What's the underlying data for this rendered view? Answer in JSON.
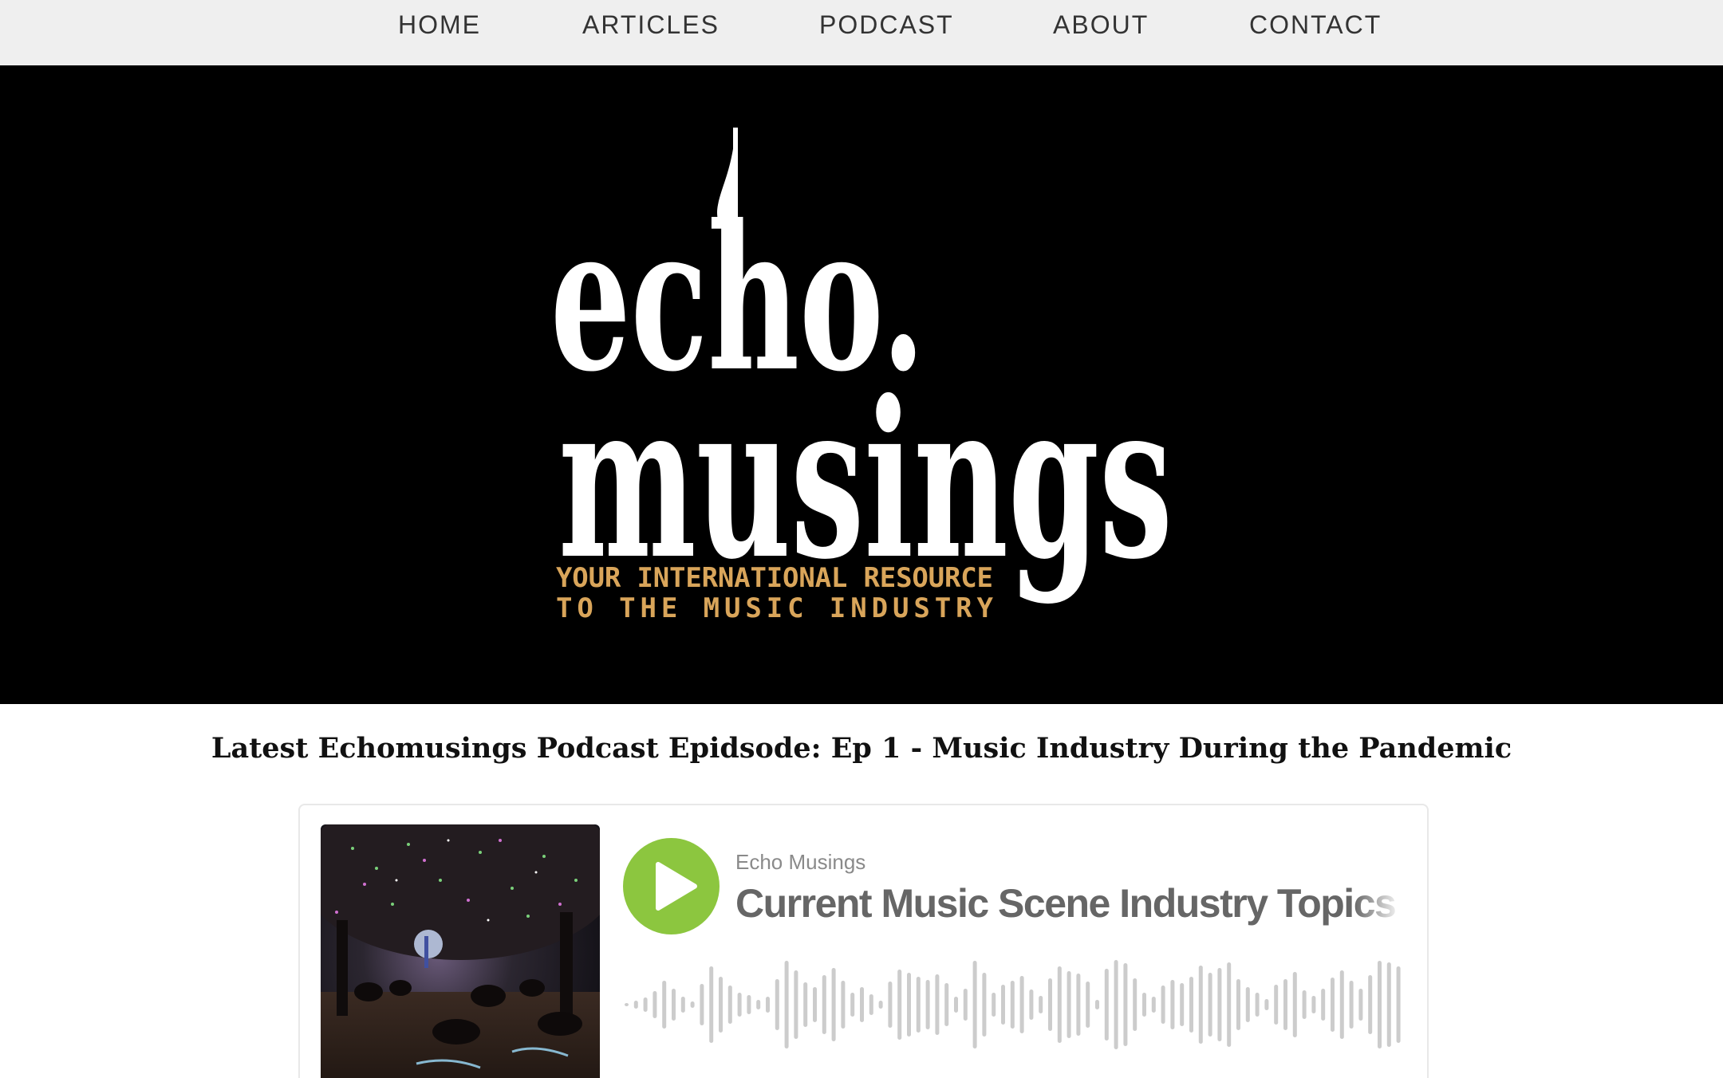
{
  "nav": {
    "items": [
      {
        "label": "HOME"
      },
      {
        "label": "ARTICLES"
      },
      {
        "label": "PODCAST"
      },
      {
        "label": "ABOUT"
      },
      {
        "label": "CONTACT"
      }
    ]
  },
  "hero": {
    "logo_line1": "echo.",
    "logo_line2": "musings",
    "tagline_line1": "YOUR INTERNATIONAL RESOURCE",
    "tagline_line2": "TO THE MUSIC INDUSTRY",
    "logo_color": "#ffffff",
    "tagline_color": "#d9a55a",
    "background": "#000000"
  },
  "episode_heading": "Latest Echomusings Podcast Epidsode: Ep 1 - Music Industry During the Pandemic",
  "player": {
    "show_name": "Echo Musings",
    "episode_title": "Current Music Scene Industry Topics -",
    "play_icon": "play-icon",
    "accent": "#8cc63f",
    "waveform_color": "#cccccc"
  }
}
